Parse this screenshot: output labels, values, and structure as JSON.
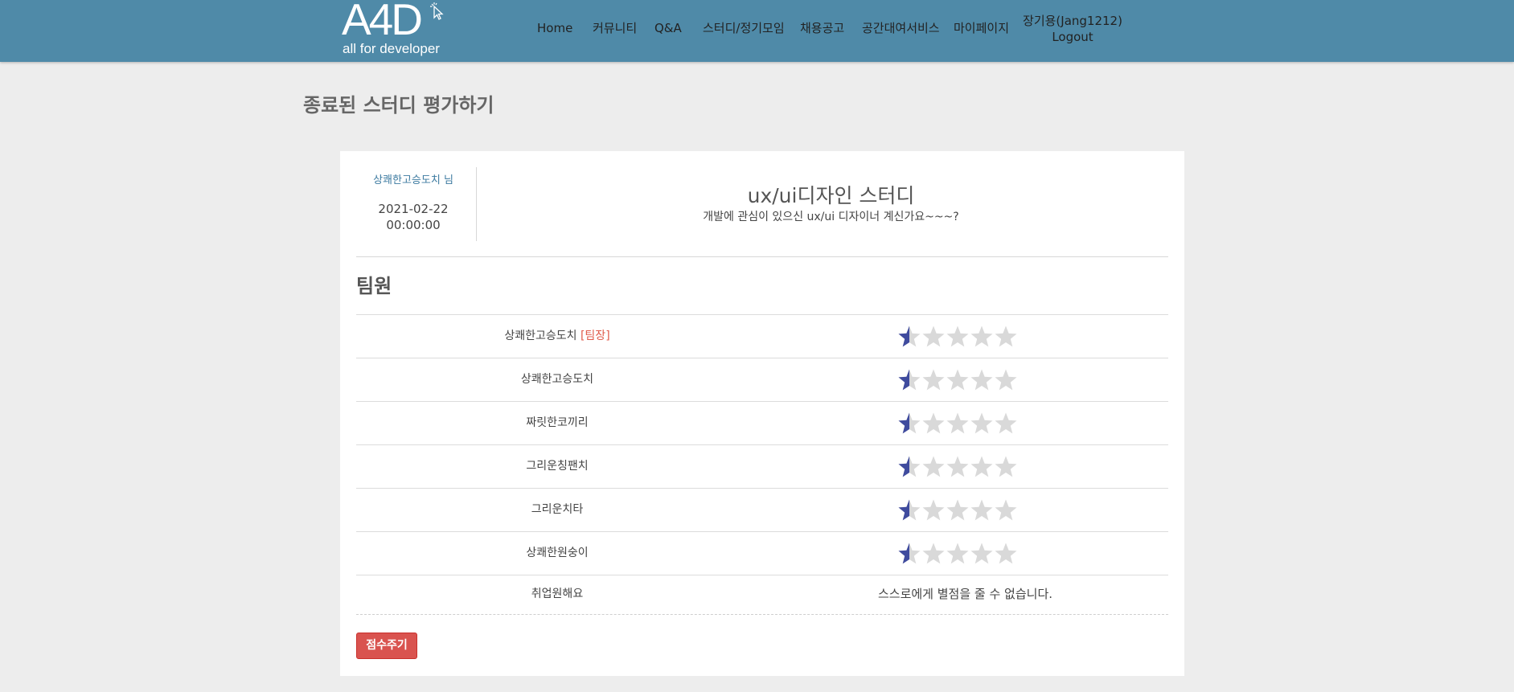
{
  "brand": {
    "logo_text": "A4D",
    "tagline": "all for developer"
  },
  "nav": {
    "items": [
      {
        "label": "Home"
      },
      {
        "label": "커뮤니티"
      },
      {
        "label": "Q&A"
      },
      {
        "label": "스터디/정기모임"
      },
      {
        "label": "채용공고"
      },
      {
        "label": "공간대여서비스"
      },
      {
        "label": "마이페이지"
      }
    ],
    "user_name": "장기용(Jang1212)",
    "logout_label": "Logout"
  },
  "page": {
    "title": "종료된 스터디 평가하기"
  },
  "study": {
    "author": "상쾌한고승도치 님",
    "date": "2021-02-22",
    "time": "00:00:00",
    "title": "ux/ui디자인 스터디",
    "description": "개발에 관심이 있으신 ux/ui 디자이너 계신가요~~~?"
  },
  "members_section": {
    "title": "팀원",
    "members": [
      {
        "name": "상쾌한고승도치",
        "tag": "[팀장]",
        "rating": 0.5,
        "max": 5
      },
      {
        "name": "상쾌한고승도치",
        "tag": "",
        "rating": 0.5,
        "max": 5
      },
      {
        "name": "짜릿한코끼리",
        "tag": "",
        "rating": 0.5,
        "max": 5
      },
      {
        "name": "그리운칭팬치",
        "tag": "",
        "rating": 0.5,
        "max": 5
      },
      {
        "name": "그리운치타",
        "tag": "",
        "rating": 0.5,
        "max": 5
      },
      {
        "name": "상쾌한원숭이",
        "tag": "",
        "rating": 0.5,
        "max": 5
      }
    ],
    "self": {
      "name": "취업원해요",
      "message": "스스로에게 별점을 줄 수 없습니다."
    }
  },
  "submit_label": "점수주기",
  "colors": {
    "header": "#4f8aa8",
    "star_filled": "#3f4b9e",
    "star_empty": "#d9d9d9",
    "button": "#d9534f"
  }
}
